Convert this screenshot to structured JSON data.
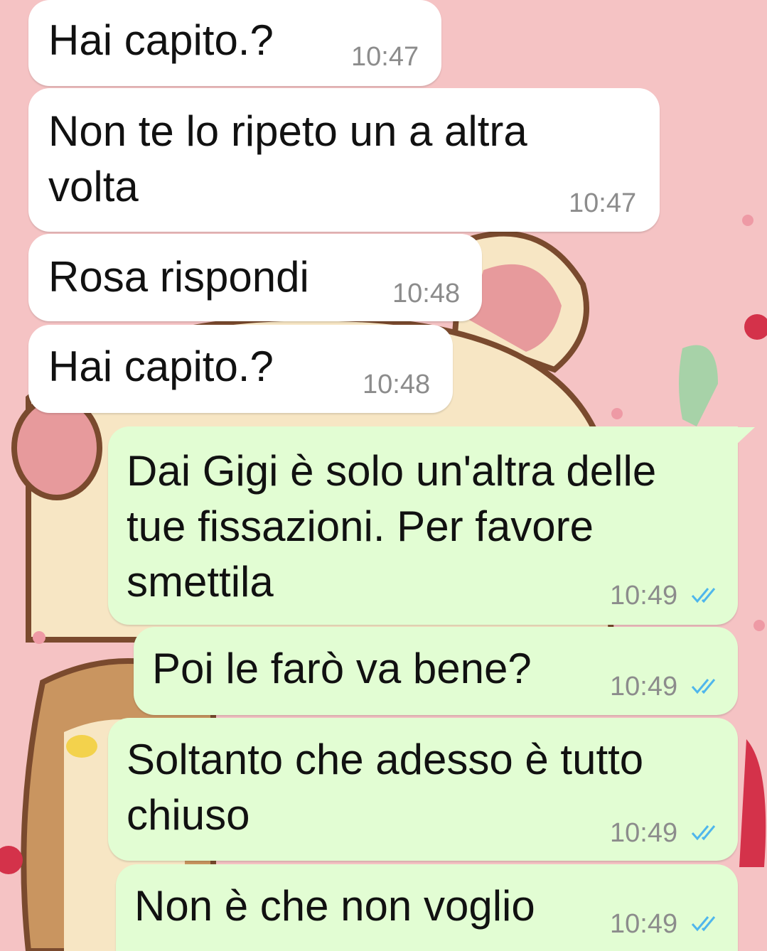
{
  "conversation": {
    "messages": [
      {
        "direction": "incoming",
        "text": "Hai capito.?",
        "time": "10:47"
      },
      {
        "direction": "incoming",
        "text": "Non te lo ripeto un a altra volta",
        "time": "10:47"
      },
      {
        "direction": "incoming",
        "text": "Rosa rispondi",
        "time": "10:48"
      },
      {
        "direction": "incoming",
        "text": "Hai capito.?",
        "time": "10:48"
      },
      {
        "direction": "outgoing",
        "text": "Dai Gigi è solo un'altra delle tue fissazioni. Per favore smettila",
        "time": "10:49",
        "status": "read"
      },
      {
        "direction": "outgoing",
        "text": "Poi le farò va bene?",
        "time": "10:49",
        "status": "read"
      },
      {
        "direction": "outgoing",
        "text": "Soltanto che adesso è tutto chiuso",
        "time": "10:49",
        "status": "read"
      },
      {
        "direction": "outgoing",
        "text": "Non è che non voglio",
        "time": "10:49",
        "status": "read"
      }
    ]
  },
  "colors": {
    "incoming_bubble": "#ffffff",
    "outgoing_bubble": "#e2fdd3",
    "read_ticks": "#4fb6ec",
    "timestamp": "#8c8c8c",
    "wallpaper": "#f5c3c4"
  },
  "wallpaper": {
    "theme": "pink-cartoon-bear-pattern"
  }
}
